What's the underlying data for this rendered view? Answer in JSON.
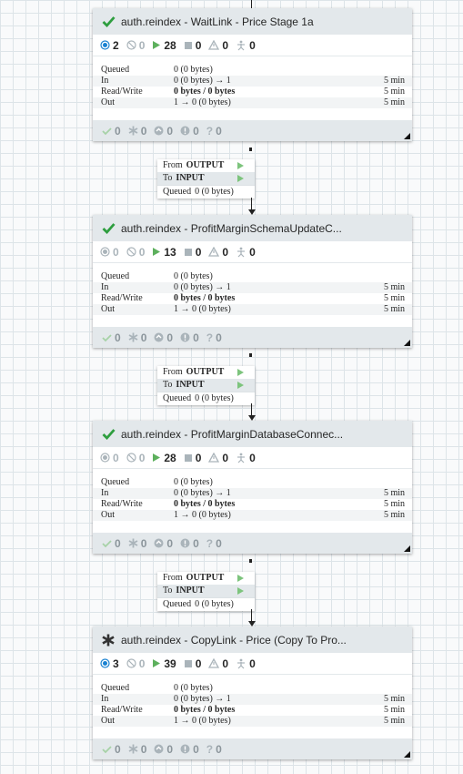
{
  "processors": [
    {
      "name": "auth.reindex - WaitLink - Price Stage 1a",
      "status_icon": "check-icon",
      "stats": {
        "transmitting": "2",
        "not_transmitting": "0",
        "running": "28",
        "stopped": "0",
        "invalid": "0",
        "disabled": "0"
      },
      "table": {
        "queued_label": "Queued",
        "queued_value": "0 (0 bytes)",
        "in_label": "In",
        "in_value": "0 (0 bytes) → 1",
        "in_time": "5 min",
        "rw_label": "Read/Write",
        "rw_value": "0 bytes / 0 bytes",
        "rw_time": "5 min",
        "out_label": "Out",
        "out_value": "1 → 0 (0 bytes)",
        "out_time": "5 min"
      },
      "bottom": {
        "up_to_date": "0",
        "locally_modified": "0",
        "stale": "0",
        "locally_modified_stale": "0",
        "sync_failure": "0"
      }
    },
    {
      "name": "auth.reindex - ProfitMarginSchemaUpdateC...",
      "status_icon": "check-icon",
      "stats": {
        "transmitting": "0",
        "not_transmitting": "0",
        "running": "13",
        "stopped": "0",
        "invalid": "0",
        "disabled": "0"
      },
      "table": {
        "queued_label": "Queued",
        "queued_value": "0 (0 bytes)",
        "in_label": "In",
        "in_value": "0 (0 bytes) → 1",
        "in_time": "5 min",
        "rw_label": "Read/Write",
        "rw_value": "0 bytes / 0 bytes",
        "rw_time": "5 min",
        "out_label": "Out",
        "out_value": "1 → 0 (0 bytes)",
        "out_time": "5 min"
      },
      "bottom": {
        "up_to_date": "0",
        "locally_modified": "0",
        "stale": "0",
        "locally_modified_stale": "0",
        "sync_failure": "0"
      }
    },
    {
      "name": "auth.reindex - ProfitMarginDatabaseConnec...",
      "status_icon": "check-icon",
      "stats": {
        "transmitting": "0",
        "not_transmitting": "0",
        "running": "28",
        "stopped": "0",
        "invalid": "0",
        "disabled": "0"
      },
      "table": {
        "queued_label": "Queued",
        "queued_value": "0 (0 bytes)",
        "in_label": "In",
        "in_value": "0 (0 bytes) → 1",
        "in_time": "5 min",
        "rw_label": "Read/Write",
        "rw_value": "0 bytes / 0 bytes",
        "rw_time": "5 min",
        "out_label": "Out",
        "out_value": "1 → 0 (0 bytes)",
        "out_time": "5 min"
      },
      "bottom": {
        "up_to_date": "0",
        "locally_modified": "0",
        "stale": "0",
        "locally_modified_stale": "0",
        "sync_failure": "0"
      }
    },
    {
      "name": "auth.reindex - CopyLink - Price (Copy To Pro...",
      "status_icon": "asterisk-icon",
      "stats": {
        "transmitting": "3",
        "not_transmitting": "0",
        "running": "39",
        "stopped": "0",
        "invalid": "0",
        "disabled": "0"
      },
      "table": {
        "queued_label": "Queued",
        "queued_value": "0 (0 bytes)",
        "in_label": "In",
        "in_value": "0 (0 bytes) → 1",
        "in_time": "5 min",
        "rw_label": "Read/Write",
        "rw_value": "0 bytes / 0 bytes",
        "rw_time": "5 min",
        "out_label": "Out",
        "out_value": "1 → 0 (0 bytes)",
        "out_time": "5 min"
      },
      "bottom": {
        "up_to_date": "0",
        "locally_modified": "0",
        "stale": "0",
        "locally_modified_stale": "0",
        "sync_failure": "0"
      }
    }
  ],
  "connections": [
    {
      "from_label": "From",
      "from_value": "OUTPUT",
      "to_label": "To",
      "to_value": "INPUT",
      "queued_label": "Queued",
      "queued_value": "0 (0 bytes)"
    },
    {
      "from_label": "From",
      "from_value": "OUTPUT",
      "to_label": "To",
      "to_value": "INPUT",
      "queued_label": "Queued",
      "queued_value": "0 (0 bytes)"
    },
    {
      "from_label": "From",
      "from_value": "OUTPUT",
      "to_label": "To",
      "to_value": "INPUT",
      "queued_label": "Queued",
      "queued_value": "0 (0 bytes)"
    }
  ],
  "colors": {
    "accent_green": "#2e9e3f",
    "transmitting_blue": "#1a82d1",
    "running_green": "#5db05d",
    "canvas": "#f9fafb",
    "header": "#e3e8eb"
  }
}
